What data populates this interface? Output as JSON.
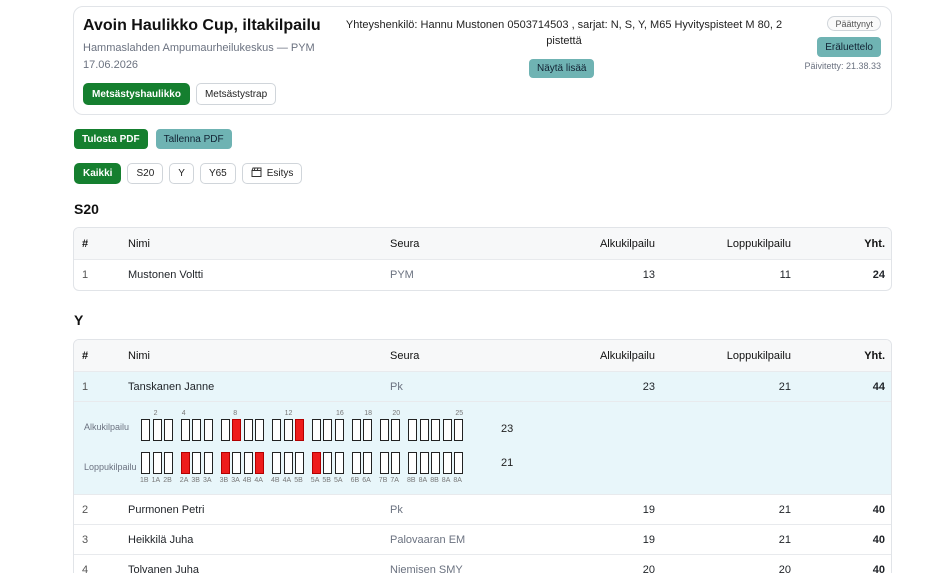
{
  "event": {
    "title": "Avoin Haulikko Cup, iltakilpailu",
    "venue": "Hammaslahden Ampumaurheilukeskus — PYM",
    "date": "17.06.2026",
    "contact": "Yhteyshenkilö: Hannu Mustonen 0503714503 , sarjat: N, S, Y, M65 Hyvityspisteet M 80, 2 pistettä",
    "show_more": "Näytä lisää",
    "status": "Päättynyt",
    "order_button": "Eräluettelo",
    "updated": "Päivitetty: 21.38.33",
    "disciplines": [
      {
        "label": "Metsästyshaulikko",
        "active": true
      },
      {
        "label": "Metsästystrap",
        "active": false
      }
    ]
  },
  "actions": {
    "print_pdf": "Tulosta PDF",
    "save_pdf": "Tallenna PDF"
  },
  "filters": [
    {
      "label": "Kaikki",
      "active": true
    },
    {
      "label": "S20",
      "active": false
    },
    {
      "label": "Y",
      "active": false
    },
    {
      "label": "Y65",
      "active": false
    },
    {
      "label": "Esitys",
      "active": false,
      "icon": "clapperboard-icon"
    }
  ],
  "columns": {
    "num": "#",
    "name": "Nimi",
    "club": "Seura",
    "qual": "Alkukilpailu",
    "final": "Loppukilpailu",
    "total": "Yht."
  },
  "sections": [
    {
      "title": "S20",
      "rows": [
        {
          "num": "1",
          "name": "Mustonen Voltti",
          "club": "PYM",
          "qual": "13",
          "final": "11",
          "total": "24"
        }
      ]
    },
    {
      "title": "Y",
      "rows": [
        {
          "num": "1",
          "name": "Tanskanen Janne",
          "club": "Pk",
          "qual": "23",
          "final": "21",
          "total": "44"
        },
        {
          "num": "2",
          "name": "Purmonen Petri",
          "club": "Pk",
          "qual": "19",
          "final": "21",
          "total": "40"
        },
        {
          "num": "3",
          "name": "Heikkilä Juha",
          "club": "Palovaaran EM",
          "qual": "19",
          "final": "21",
          "total": "40"
        },
        {
          "num": "4",
          "name": "Tolvanen Juha",
          "club": "Niemisen SMY",
          "qual": "20",
          "final": "20",
          "total": "40"
        }
      ]
    }
  ],
  "detail": {
    "qual_label": "Alkukilpailu",
    "final_label": "Loppukilpailu",
    "qual_total": "23",
    "final_total": "21",
    "qual_ticks": [
      "2",
      "4",
      "8",
      "12",
      "16",
      "18",
      "20",
      "25"
    ],
    "final_subs": [
      "1B",
      "1A",
      "2B",
      "2A",
      "3B",
      "3A",
      "3B",
      "3A",
      "4B",
      "4A",
      "4B",
      "4A",
      "5B",
      "5A",
      "5B",
      "5A",
      "6B",
      "6A",
      "7B",
      "7A",
      "8B",
      "8A",
      "8B",
      "8A",
      "8A"
    ],
    "qual_shots": [
      1,
      1,
      1,
      1,
      1,
      1,
      1,
      0,
      1,
      1,
      1,
      1,
      0,
      1,
      1,
      1,
      1,
      1,
      1,
      1,
      1,
      1,
      1,
      1,
      1
    ],
    "final_shots": [
      1,
      1,
      1,
      0,
      1,
      1,
      0,
      1,
      1,
      0,
      1,
      1,
      1,
      0,
      1,
      1,
      1,
      1,
      1,
      1,
      1,
      1,
      1,
      1,
      1
    ],
    "hit_color": "#ffffff",
    "miss_color": "#ee1c1c"
  },
  "colors": {
    "accent_green": "#157f2f",
    "accent_teal": "#6fb3b3",
    "highlight_row": "#e8f6fa"
  }
}
